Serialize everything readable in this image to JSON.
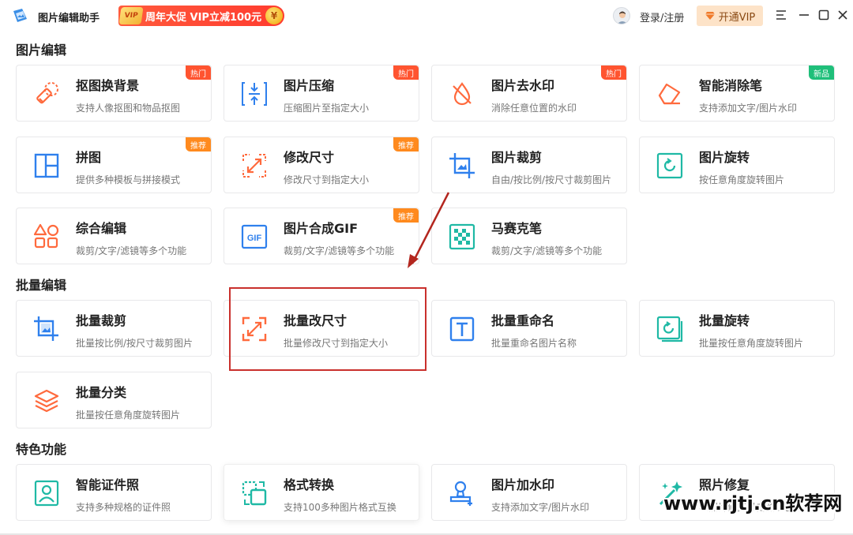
{
  "app": {
    "name": "图片编辑助手",
    "promo_text": "周年大促 VIP立减100元",
    "promo_tag": "VIP",
    "promo_coin": "¥",
    "login_label": "登录/注册",
    "vip_button_label": "开通VIP"
  },
  "sections": {
    "edit": {
      "title": "图片编辑",
      "cards": [
        {
          "title": "抠图换背景",
          "desc": "支持人像抠图和物品抠图",
          "badge": "热门",
          "icon": "eraser-icon"
        },
        {
          "title": "图片压缩",
          "desc": "压缩图片至指定大小",
          "badge": "热门",
          "icon": "compress-icon"
        },
        {
          "title": "图片去水印",
          "desc": "消除任意位置的水印",
          "badge": "热门",
          "icon": "no-watermark-icon"
        },
        {
          "title": "智能消除笔",
          "desc": "支持添加文字/图片水印",
          "badge": "新品",
          "icon": "eraser-pen-icon"
        },
        {
          "title": "拼图",
          "desc": "提供多种模板与拼接模式",
          "badge": "推荐",
          "icon": "collage-icon"
        },
        {
          "title": "修改尺寸",
          "desc": "修改尺寸到指定大小",
          "badge": "推荐",
          "icon": "resize-icon"
        },
        {
          "title": "图片裁剪",
          "desc": "自由/按比例/按尺寸裁剪图片",
          "badge": "",
          "icon": "crop-icon"
        },
        {
          "title": "图片旋转",
          "desc": "按任意角度旋转图片",
          "badge": "",
          "icon": "rotate-icon"
        },
        {
          "title": "综合编辑",
          "desc": "裁剪/文字/滤镜等多个功能",
          "badge": "",
          "icon": "shapes-icon"
        },
        {
          "title": "图片合成GIF",
          "desc": "裁剪/文字/滤镜等多个功能",
          "badge": "推荐",
          "icon": "gif-icon"
        },
        {
          "title": "马赛克笔",
          "desc": "裁剪/文字/滤镜等多个功能",
          "badge": "",
          "icon": "mosaic-icon"
        }
      ]
    },
    "batch": {
      "title": "批量编辑",
      "cards": [
        {
          "title": "批量裁剪",
          "desc": "批量按比例/按尺寸裁剪图片",
          "badge": "",
          "icon": "batch-crop-icon"
        },
        {
          "title": "批量改尺寸",
          "desc": "批量修改尺寸到指定大小",
          "badge": "",
          "icon": "batch-resize-icon"
        },
        {
          "title": "批量重命名",
          "desc": "批量重命名图片名称",
          "badge": "",
          "icon": "rename-icon"
        },
        {
          "title": "批量旋转",
          "desc": "批量按任意角度旋转图片",
          "badge": "",
          "icon": "batch-rotate-icon"
        },
        {
          "title": "批量分类",
          "desc": "批量按任意角度旋转图片",
          "badge": "",
          "icon": "layers-icon"
        }
      ]
    },
    "special": {
      "title": "特色功能",
      "cards": [
        {
          "title": "智能证件照",
          "desc": "支持多种规格的证件照",
          "badge": "",
          "icon": "id-photo-icon"
        },
        {
          "title": "格式转换",
          "desc": "支持100多种图片格式互换",
          "badge": "",
          "icon": "convert-icon"
        },
        {
          "title": "图片加水印",
          "desc": "支持添加文字/图片水印",
          "badge": "",
          "icon": "stamp-icon"
        },
        {
          "title": "照片修复",
          "desc": "老照片修复黑白照上色等",
          "badge": "",
          "icon": "magic-wand-icon"
        }
      ]
    }
  },
  "watermark": "www.rjtj.cn软荐网",
  "colors": {
    "hot": "#ff5430",
    "recommend": "#ff8a1e",
    "new": "#1fbf7a",
    "highlight": "#c9302c"
  }
}
